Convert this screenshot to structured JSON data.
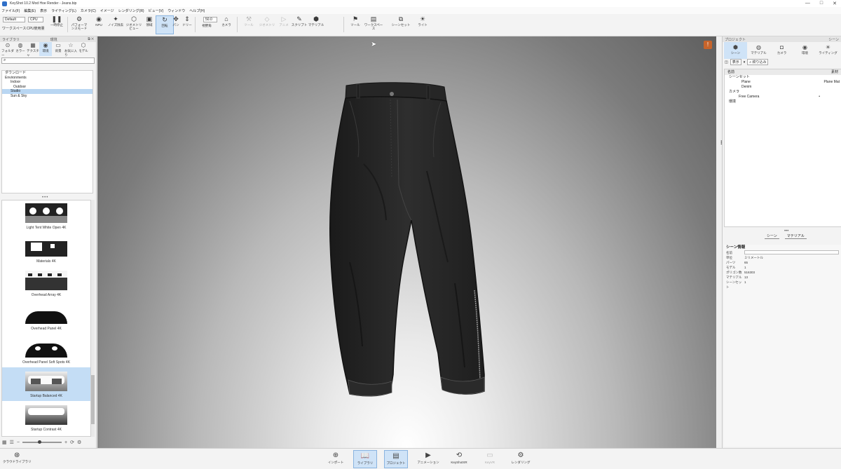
{
  "window": {
    "title": "KeyShot 10.2 Mod Hoe Render - Jeans.bip",
    "controls": [
      "—",
      "□",
      "✕"
    ]
  },
  "menu": [
    "ファイル(F)",
    "編集(E)",
    "表示",
    "ライティング(L)",
    "カメラ(C)",
    "イメージ",
    "レンダリング(R)",
    "ビュー(V)",
    "ウィンドウ",
    "ヘルプ(H)"
  ],
  "toolbar": {
    "workspace_value": "Default",
    "cpu_value": "CPU",
    "workspace_label": "ワークスペース",
    "cpu_usage_label": "CPU使用量",
    "pause_label": "一時停止",
    "buttons": [
      {
        "label": "パフォーマンスモード",
        "icon": "performance-icon"
      },
      {
        "label": "NPU",
        "icon": "npu-icon"
      },
      {
        "label": "ノイズ除去",
        "icon": "denoise-icon"
      },
      {
        "label": "ジオメトリビュー",
        "icon": "geometry-view-icon"
      },
      {
        "label": "領域",
        "icon": "region-icon"
      },
      {
        "label": "回転",
        "icon": "tumble-icon"
      },
      {
        "label": "パン",
        "icon": "pan-icon"
      },
      {
        "label": "ドリー",
        "icon": "dolly-icon"
      },
      {
        "label": "視野角",
        "icon": "fov-icon"
      },
      {
        "label": "カメラ",
        "icon": "camera-icon"
      },
      {
        "label": "ツール",
        "icon": "tools-icon"
      },
      {
        "label": "ジオメトリ",
        "icon": "geometry-icon"
      },
      {
        "label": "アニメ",
        "icon": "animation-icon"
      },
      {
        "label": "スクリプト",
        "icon": "script-icon"
      },
      {
        "label": "マテリアル",
        "icon": "material-icon"
      },
      {
        "label": "ツール",
        "icon": "tool-icon"
      },
      {
        "label": "ワークスペース",
        "icon": "workspace-icon"
      },
      {
        "label": "シーンセット",
        "icon": "sceneset-icon"
      },
      {
        "label": "ライト",
        "icon": "light-icon"
      }
    ],
    "fov_value": "50.0"
  },
  "left_panel": {
    "header_left": "ライブラリ",
    "header_right": "環境",
    "tabs": [
      {
        "label": "フォルダー",
        "icon": "folder-icon"
      },
      {
        "label": "カラー",
        "icon": "color-icon"
      },
      {
        "label": "テクスチャ",
        "icon": "texture-icon"
      },
      {
        "label": "環境",
        "icon": "environment-icon"
      },
      {
        "label": "背景",
        "icon": "background-icon"
      },
      {
        "label": "お気に入り",
        "icon": "favorite-icon"
      },
      {
        "label": "モデル",
        "icon": "model-icon"
      }
    ],
    "search_placeholder": "⌕",
    "tree": [
      {
        "label": "ダウンロード",
        "level": 0,
        "selected": false
      },
      {
        "label": "Environments",
        "level": 0,
        "selected": false
      },
      {
        "label": "Indoor",
        "level": 1,
        "selected": false
      },
      {
        "label": "Outdoor",
        "level": 1,
        "selected": false
      },
      {
        "label": "Studio",
        "level": 1,
        "selected": true
      },
      {
        "label": "Sun & Sky",
        "level": 1,
        "selected": false
      }
    ],
    "thumbnails": [
      {
        "caption": "Light Tent White Open 4K",
        "selected": false
      },
      {
        "caption": "Materials 4K",
        "selected": false
      },
      {
        "caption": "Overhead Array 4K",
        "selected": false
      },
      {
        "caption": "Overhead Panel 4K",
        "selected": false
      },
      {
        "caption": "Overhead Panel Soft Spots 4K",
        "selected": false
      },
      {
        "caption": "Startup Balanced 4K",
        "selected": true
      },
      {
        "caption": "Startup Contrast 4K",
        "selected": false
      }
    ]
  },
  "viewport": {
    "warning": "!"
  },
  "right_panel": {
    "header_left": "プロジェクト",
    "header_right": "シーン",
    "tabs": [
      {
        "label": "シーン",
        "icon": "scene-icon"
      },
      {
        "label": "マテリアル",
        "icon": "material-ball-icon"
      },
      {
        "label": "カメラ",
        "icon": "camera-tab-icon"
      },
      {
        "label": "環境",
        "icon": "env-tab-icon"
      },
      {
        "label": "ライティング",
        "icon": "lighting-tab-icon"
      },
      {
        "label": "イメージ",
        "icon": "image-tab-icon"
      }
    ],
    "toolbar_label": "表示",
    "search_placeholder": "⌕ 絞り込み",
    "tree_header_name": "名前",
    "tree_header_material": "素材",
    "tree": [
      {
        "label": "シーンセット",
        "right": ""
      },
      {
        "label": "Plane",
        "right": "Plane Mat"
      },
      {
        "label": "Denim",
        "right": ""
      },
      {
        "label": "カメラ",
        "right": ""
      },
      {
        "label": "Free Camera",
        "right": "•"
      },
      {
        "label": "環境",
        "right": ""
      }
    ],
    "bottom_tabs": [
      "シーン",
      "マテリアル"
    ],
    "props_title": "シーン情報",
    "props": [
      {
        "k": "名前",
        "v": ""
      },
      {
        "k": "単位",
        "v": "ミリメートル"
      },
      {
        "k": "パーツ",
        "v": "65"
      },
      {
        "k": "モデル",
        "v": "1"
      },
      {
        "k": "ポリゴン数",
        "v": "516303"
      },
      {
        "k": "マテリアル",
        "v": "13"
      },
      {
        "k": "シーンセット",
        "v": "1"
      }
    ]
  },
  "bottombar": {
    "cloud_label": "クラウドライブラリ",
    "buttons": [
      {
        "label": "インポート",
        "icon": "import-icon",
        "active": false,
        "dim": false
      },
      {
        "label": "ライブラリ",
        "icon": "library-icon",
        "active": true,
        "dim": false
      },
      {
        "label": "プロジェクト",
        "icon": "project-icon",
        "active": true,
        "dim": false
      },
      {
        "label": "アニメーション",
        "icon": "animation-play-icon",
        "active": false,
        "dim": false
      },
      {
        "label": "KeyShotXR",
        "icon": "keyshotxr-icon",
        "active": false,
        "dim": false
      },
      {
        "label": "KeyVR",
        "icon": "keyvr-icon",
        "active": false,
        "dim": true
      },
      {
        "label": "レンダリング",
        "icon": "render-icon",
        "active": false,
        "dim": false
      }
    ]
  }
}
